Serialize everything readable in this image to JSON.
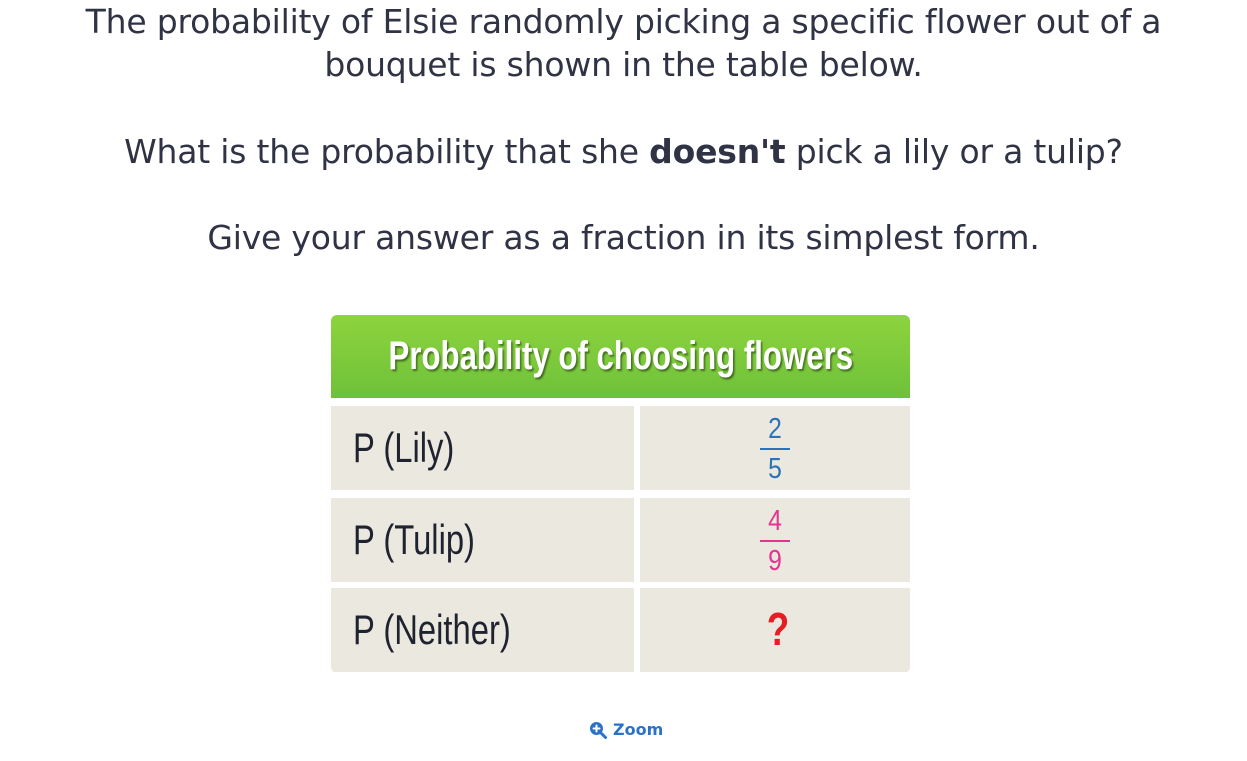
{
  "question": {
    "line1a": "The probability of Elsie randomly picking a specific flower out of a",
    "line1b": "bouquet is shown in the table below.",
    "line2_before": "What is the probability that she ",
    "line2_bold": "doesn't",
    "line2_after": " pick a lily or a tulip?",
    "line3": "Give your answer as a fraction in its simplest form."
  },
  "table": {
    "title": "Probability of choosing flowers",
    "header_color": "#7bc93c",
    "rows": [
      {
        "label": "P (Lily)",
        "numerator": "2",
        "denominator": "5",
        "color": "#2b73b8"
      },
      {
        "label": "P (Tulip)",
        "numerator": "4",
        "denominator": "9",
        "color": "#e5338f"
      },
      {
        "label": "P (Neither)",
        "value": "?",
        "color": "#e31e24"
      }
    ]
  },
  "zoom": {
    "label": "Zoom",
    "icon": "zoom-in-icon"
  }
}
